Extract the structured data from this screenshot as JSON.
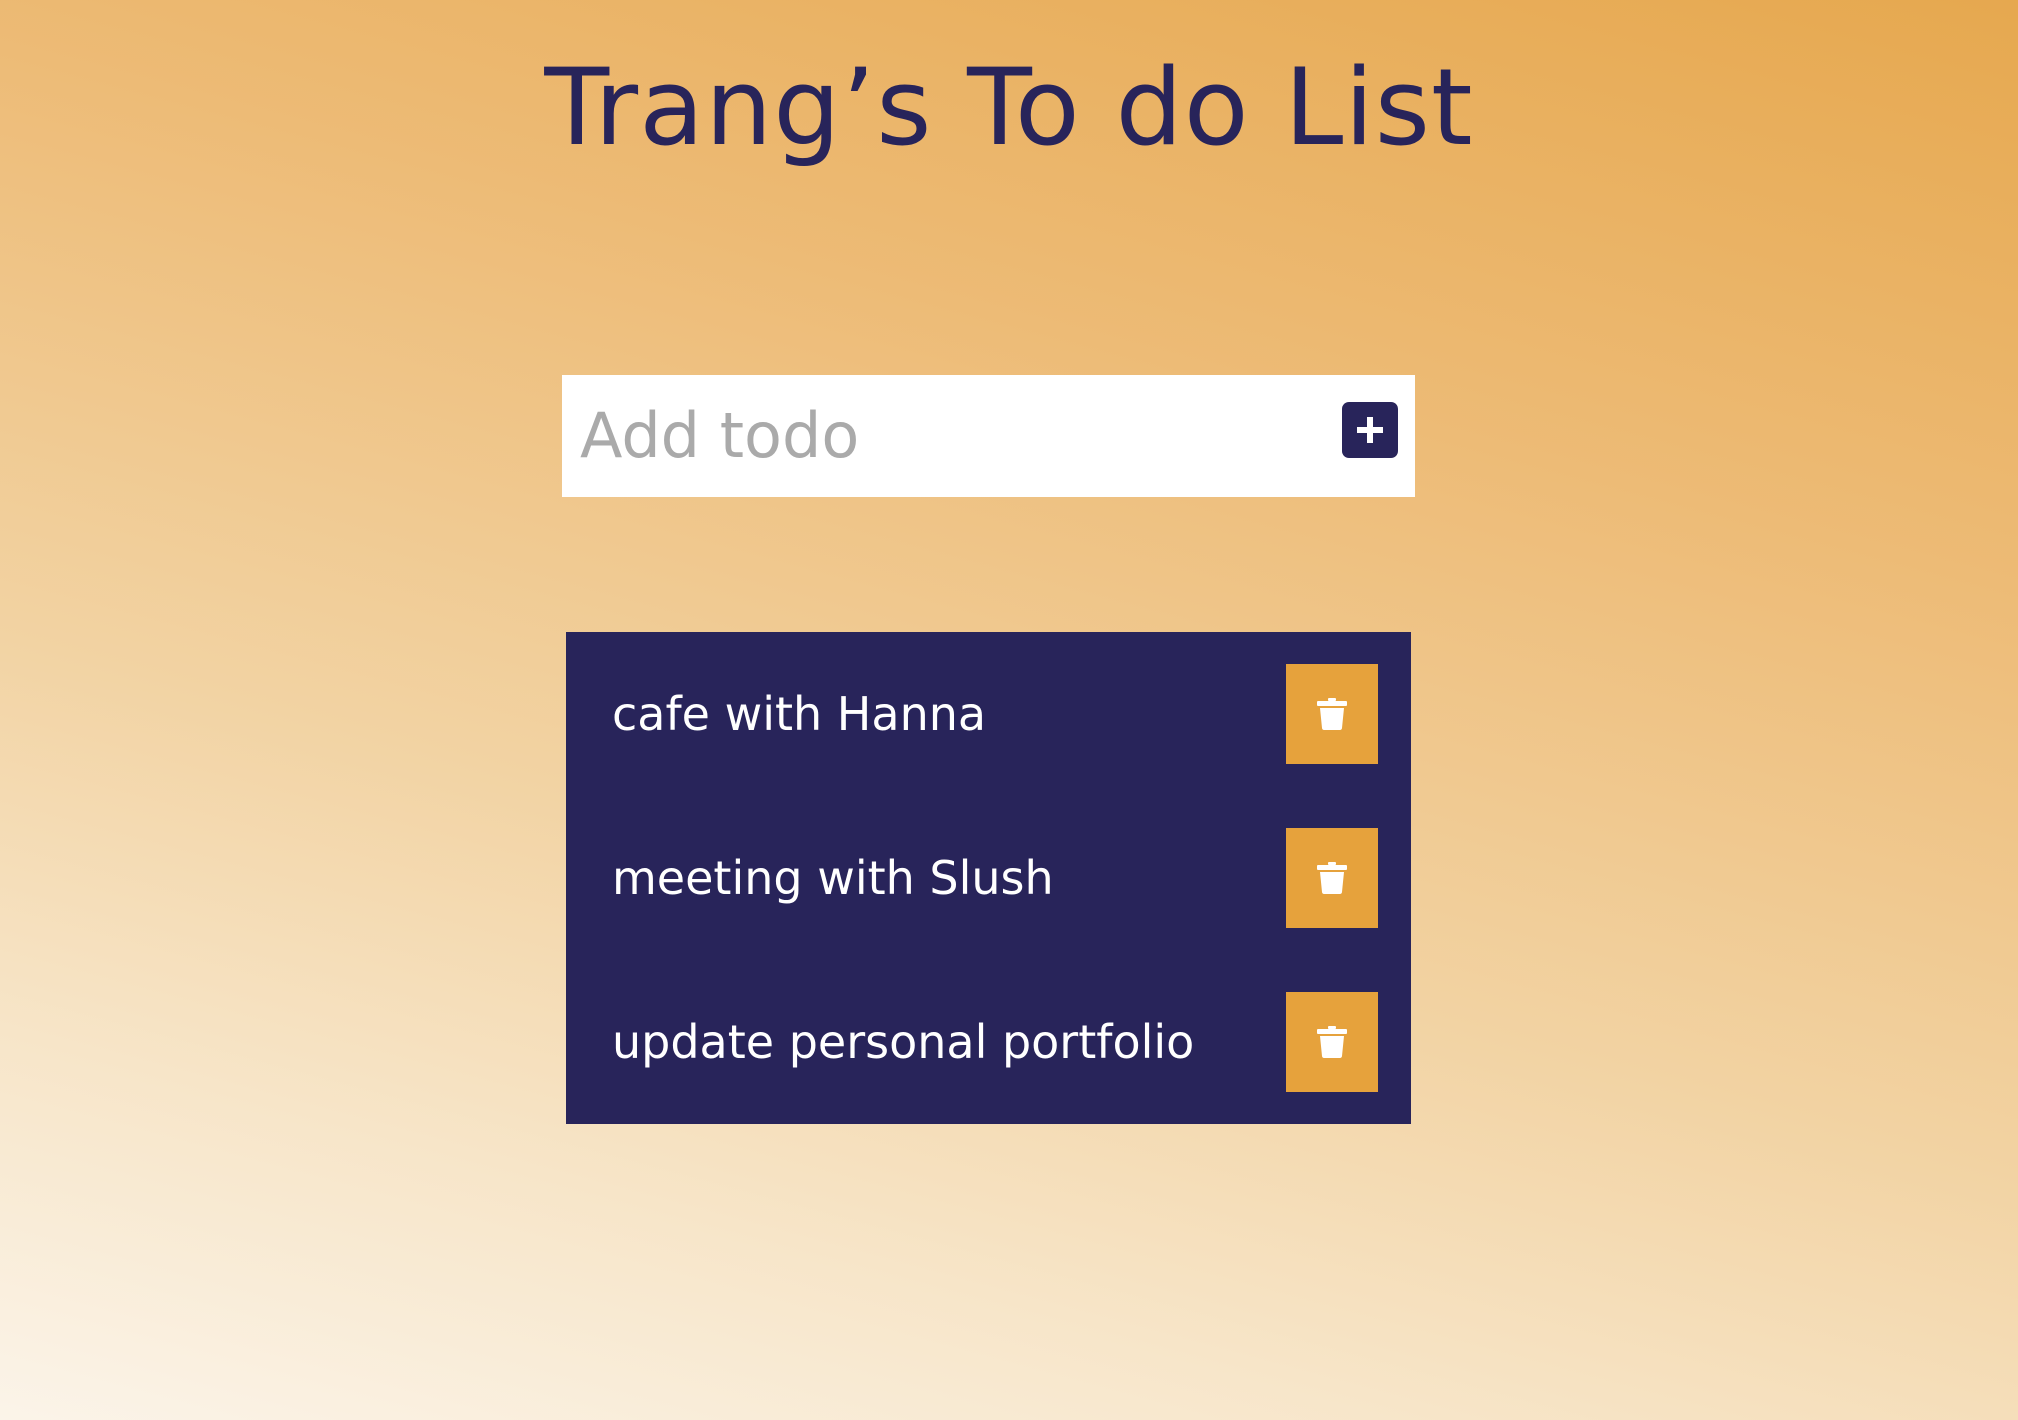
{
  "header": {
    "title": "Trang’s To do List"
  },
  "add_form": {
    "placeholder": "Add todo",
    "value": "",
    "add_icon": "plus-icon"
  },
  "todos": [
    {
      "text": "cafe with Hanna",
      "delete_icon": "trash-icon"
    },
    {
      "text": "meeting with Slush",
      "delete_icon": "trash-icon"
    },
    {
      "text": "update personal portfolio",
      "delete_icon": "trash-icon"
    }
  ],
  "colors": {
    "navy": "#28245a",
    "accent": "#e6a23c",
    "gradient_top": "#e6a84f",
    "gradient_bottom": "#fbf4e9"
  }
}
